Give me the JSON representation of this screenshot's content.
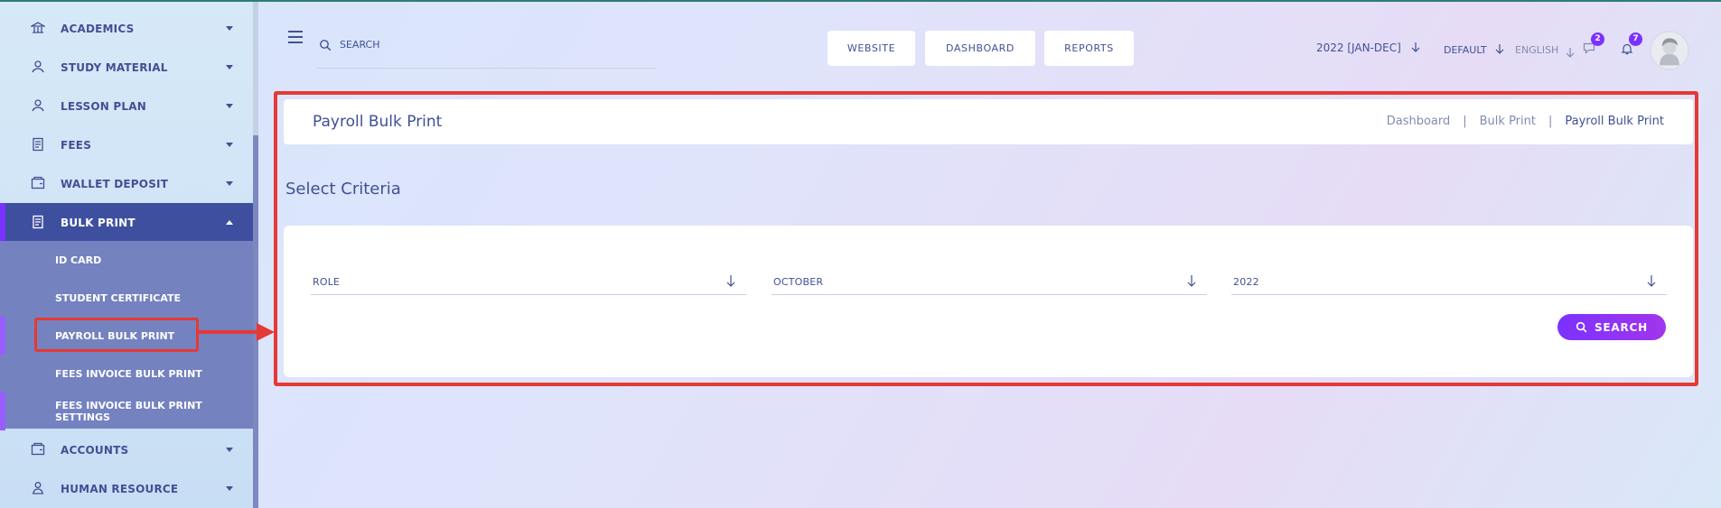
{
  "sidebar": {
    "items": [
      {
        "label": "ACADEMICS",
        "icon": "academics-icon"
      },
      {
        "label": "STUDY MATERIAL",
        "icon": "study-material-icon"
      },
      {
        "label": "LESSON PLAN",
        "icon": "lesson-plan-icon"
      },
      {
        "label": "FEES",
        "icon": "fees-icon"
      },
      {
        "label": "WALLET DEPOSIT",
        "icon": "wallet-icon"
      },
      {
        "label": "BULK PRINT",
        "icon": "bulk-print-icon",
        "active": true
      },
      {
        "label": "ACCOUNTS",
        "icon": "accounts-icon"
      },
      {
        "label": "HUMAN RESOURCE",
        "icon": "human-resource-icon"
      }
    ],
    "submenu": [
      {
        "label": "ID CARD"
      },
      {
        "label": "STUDENT CERTIFICATE"
      },
      {
        "label": "PAYROLL BULK PRINT",
        "selected": true
      },
      {
        "label": "FEES INVOICE BULK PRINT"
      },
      {
        "label": "FEES INVOICE BULK PRINT SETTINGS"
      }
    ]
  },
  "header": {
    "search_placeholder": "SEARCH",
    "buttons": [
      "WEBSITE",
      "DASHBOARD",
      "REPORTS"
    ],
    "session": "2022 [JAN-DEC]",
    "theme": "DEFAULT",
    "language": "ENGLISH",
    "messages_count": "2",
    "notifications_count": "7"
  },
  "main": {
    "page_title": "Payroll Bulk Print",
    "breadcrumb": [
      "Dashboard",
      "Bulk Print",
      "Payroll Bulk Print"
    ],
    "breadcrumb_sep": "|",
    "section_title": "Select Criteria",
    "fields": [
      "ROLE",
      "OCTOBER",
      "2022"
    ],
    "search_button": "SEARCH"
  },
  "colors": {
    "accent": "#7c32ff",
    "primary_text": "#415094",
    "highlight": "#e53935",
    "active_menu": "#3f4fa0",
    "submenu_bg": "#7482c0"
  }
}
